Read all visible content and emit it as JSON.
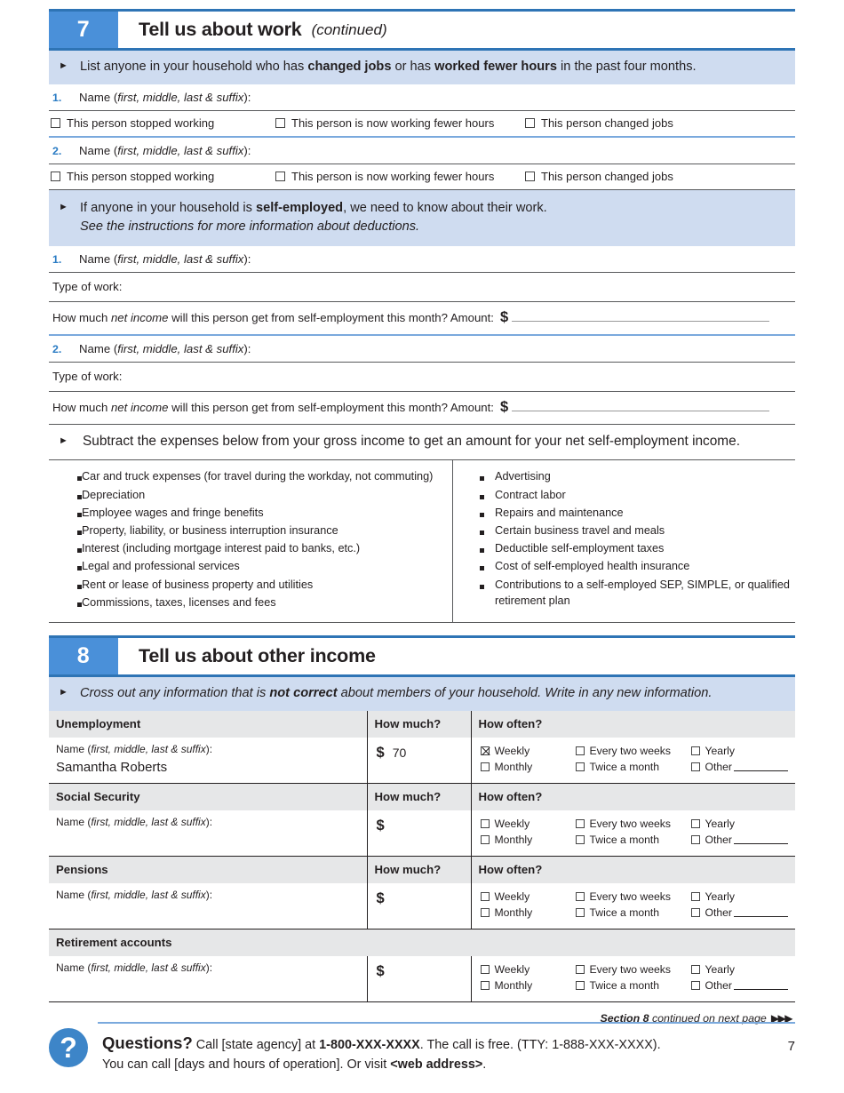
{
  "page": {
    "number": "7"
  },
  "section7": {
    "number": "7",
    "title": "Tell us about work",
    "continued": "(continued)",
    "instruction1": {
      "pre": "List anyone in your household who has ",
      "bold1": "changed jobs",
      "mid": " or has ",
      "bold2": "worked fewer hours",
      "post": " in the past four months."
    },
    "name_label_pre": "Name (",
    "name_label_ital": "first, middle, last & suffix",
    "name_label_post": "):",
    "person_numbers": [
      "1.",
      "2."
    ],
    "job_checkboxes": [
      "This person stopped working",
      "This person is now working fewer hours",
      "This person changed jobs"
    ],
    "instruction2": {
      "pre": "If anyone in your household is ",
      "bold": "self-employed",
      "post": ", we need to know about their work.",
      "line2": "See the instructions for more information about deductions."
    },
    "type_of_work_label": "Type of work:",
    "net_income_question_pre": "How much ",
    "net_income_question_ital": "net income",
    "net_income_question_post": " will this person get from self-employment this month?  Amount:",
    "dollar_sign": "$",
    "instruction3": "Subtract the expenses below from your gross income to get an amount for your net self-employment income.",
    "expenses_left": [
      "Car and truck expenses (for travel during the workday, not commuting)",
      "Depreciation",
      "Employee wages and fringe benefits",
      "Property, liability, or business interruption insurance",
      "Interest (including mortgage interest paid to banks, etc.)",
      "Legal and professional services",
      "Rent or lease of business property and utilities",
      "Commissions, taxes, licenses and fees"
    ],
    "expenses_right": [
      "Advertising",
      "Contract labor",
      "Repairs and maintenance",
      "Certain business travel and meals",
      "Deductible self-employment taxes",
      "Cost of self-employed health insurance",
      "Contributions to a self-employed SEP, SIMPLE, or qualified retirement plan"
    ]
  },
  "section8": {
    "number": "8",
    "title": "Tell us about other income",
    "instruction": {
      "pre": "Cross out any information that is ",
      "bold": "not correct",
      "post": " about members of your household. Write in any new information."
    },
    "col_headers": {
      "how_much": "How much?",
      "how_often": "How often?"
    },
    "name_label_pre": "Name (",
    "name_label_ital": "first, middle, last & suffix",
    "name_label_post": "):",
    "dollar_sign": "$",
    "frequency_options": [
      "Weekly",
      "Every two weeks",
      "Yearly",
      "Monthly",
      "Twice a month",
      "Other"
    ],
    "rows": [
      {
        "category": "Unemployment",
        "show_how_much": true,
        "show_how_often": true,
        "name_value": "Samantha Roberts",
        "amount": "70",
        "checked": [
          "Weekly"
        ]
      },
      {
        "category": "Social Security",
        "show_how_much": true,
        "show_how_often": true,
        "name_value": "",
        "amount": "",
        "checked": []
      },
      {
        "category": "Pensions",
        "show_how_much": true,
        "show_how_often": true,
        "name_value": "",
        "amount": "",
        "checked": []
      },
      {
        "category": "Retirement accounts",
        "show_how_much": false,
        "show_how_often": false,
        "name_value": "",
        "amount": "",
        "checked": []
      }
    ],
    "continued_note_bold": "Section 8",
    "continued_note_rest": " continued on next page",
    "continued_arrows": "▶▶▶"
  },
  "footer": {
    "icon": "?",
    "questions_label": "Questions?",
    "line1_a": " Call [state agency] at ",
    "line1_bold": "1-800-XXX-XXXX",
    "line1_b": ". The call is free. (TTY: 1-888-XXX-XXXX).",
    "line2_a": "You can call [days and hours of operation]. Or visit ",
    "line2_bold": "<web address>",
    "line2_b": ".",
    "page_number": "7"
  },
  "colors": {
    "accent_blue": "#4a90d9",
    "rule_blue": "#2e74b5",
    "banner_blue": "#cfdcf0",
    "light_blue_rule": "#7aa9dd",
    "header_gray": "#e6e7e8"
  }
}
